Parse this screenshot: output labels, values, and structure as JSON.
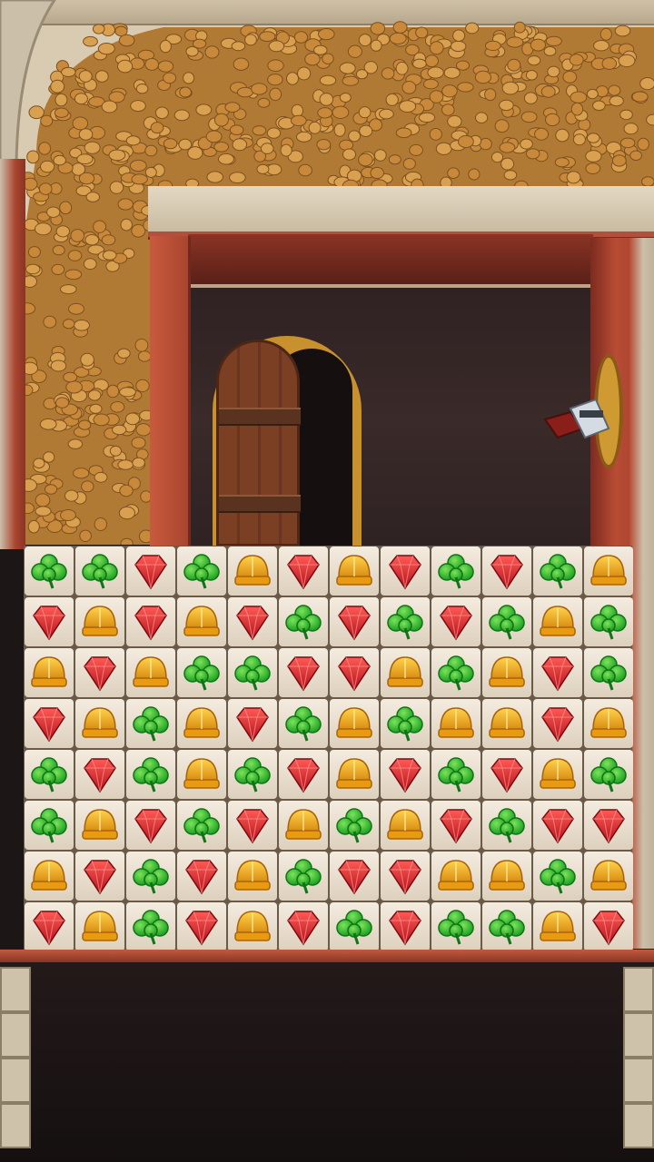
{
  "scene": {
    "door_state": "open",
    "character": "knight-peeking"
  },
  "colors": {
    "clover": "#27b52a",
    "gem": "#d9262b",
    "helmet": "#f2b21c",
    "tile": "#efe5d6",
    "gold": "#c98e3a"
  },
  "board": {
    "columns": 12,
    "rows": [
      [
        "clover",
        "clover",
        "gem",
        "clover",
        "helmet",
        "gem",
        "helmet",
        "gem",
        "clover",
        "gem",
        "clover",
        "helmet"
      ],
      [
        "gem",
        "helmet",
        "gem",
        "helmet",
        "gem",
        "clover",
        "gem",
        "clover",
        "gem",
        "clover",
        "helmet",
        "clover"
      ],
      [
        "helmet",
        "gem",
        "helmet",
        "clover",
        "clover",
        "gem",
        "gem",
        "helmet",
        "clover",
        "helmet",
        "gem",
        "clover"
      ],
      [
        "gem",
        "helmet",
        "clover",
        "helmet",
        "gem",
        "clover",
        "helmet",
        "clover",
        "helmet",
        "helmet",
        "gem",
        "helmet"
      ],
      [
        "clover",
        "gem",
        "clover",
        "helmet",
        "clover",
        "gem",
        "helmet",
        "gem",
        "clover",
        "gem",
        "helmet",
        "clover"
      ],
      [
        "clover",
        "helmet",
        "gem",
        "clover",
        "gem",
        "helmet",
        "clover",
        "helmet",
        "gem",
        "clover",
        "gem",
        "gem"
      ],
      [
        "helmet",
        "gem",
        "clover",
        "gem",
        "helmet",
        "clover",
        "gem",
        "gem",
        "helmet",
        "helmet",
        "clover",
        "helmet"
      ],
      [
        "gem",
        "helmet",
        "clover",
        "gem",
        "helmet",
        "gem",
        "clover",
        "gem",
        "clover",
        "clover",
        "helmet",
        "gem"
      ]
    ]
  }
}
